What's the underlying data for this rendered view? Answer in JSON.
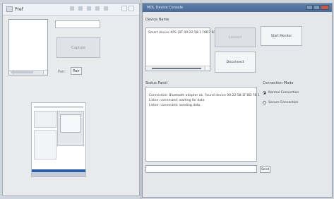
{
  "left_window": {
    "title": "Pref",
    "big_button_label": "Capture",
    "small_label": "Pair:",
    "small_button_label": "Pair"
  },
  "right_window": {
    "title": "MDL Device Console",
    "devices_label": "Device Name",
    "device_items": [
      "Smart device XPS (BT 00:22:58:1 F8D7 B1)"
    ],
    "connect_button": "Connect",
    "disconnect_button": "Disconnect",
    "start_button": "Start Monitor",
    "status_label": "Status Panel",
    "status_lines": [
      "Connection: Bluetooth adapter ok. Found device 00:22:58:1F:8D:7B 1",
      "Listen: connected: waiting for data",
      "Listen: connected: sending data"
    ],
    "options_label": "Connection Mode",
    "radio_options": [
      {
        "label": "Normal Connection",
        "selected": true
      },
      {
        "label": "Secure Connection",
        "selected": false
      }
    ],
    "send_button": "Send"
  }
}
